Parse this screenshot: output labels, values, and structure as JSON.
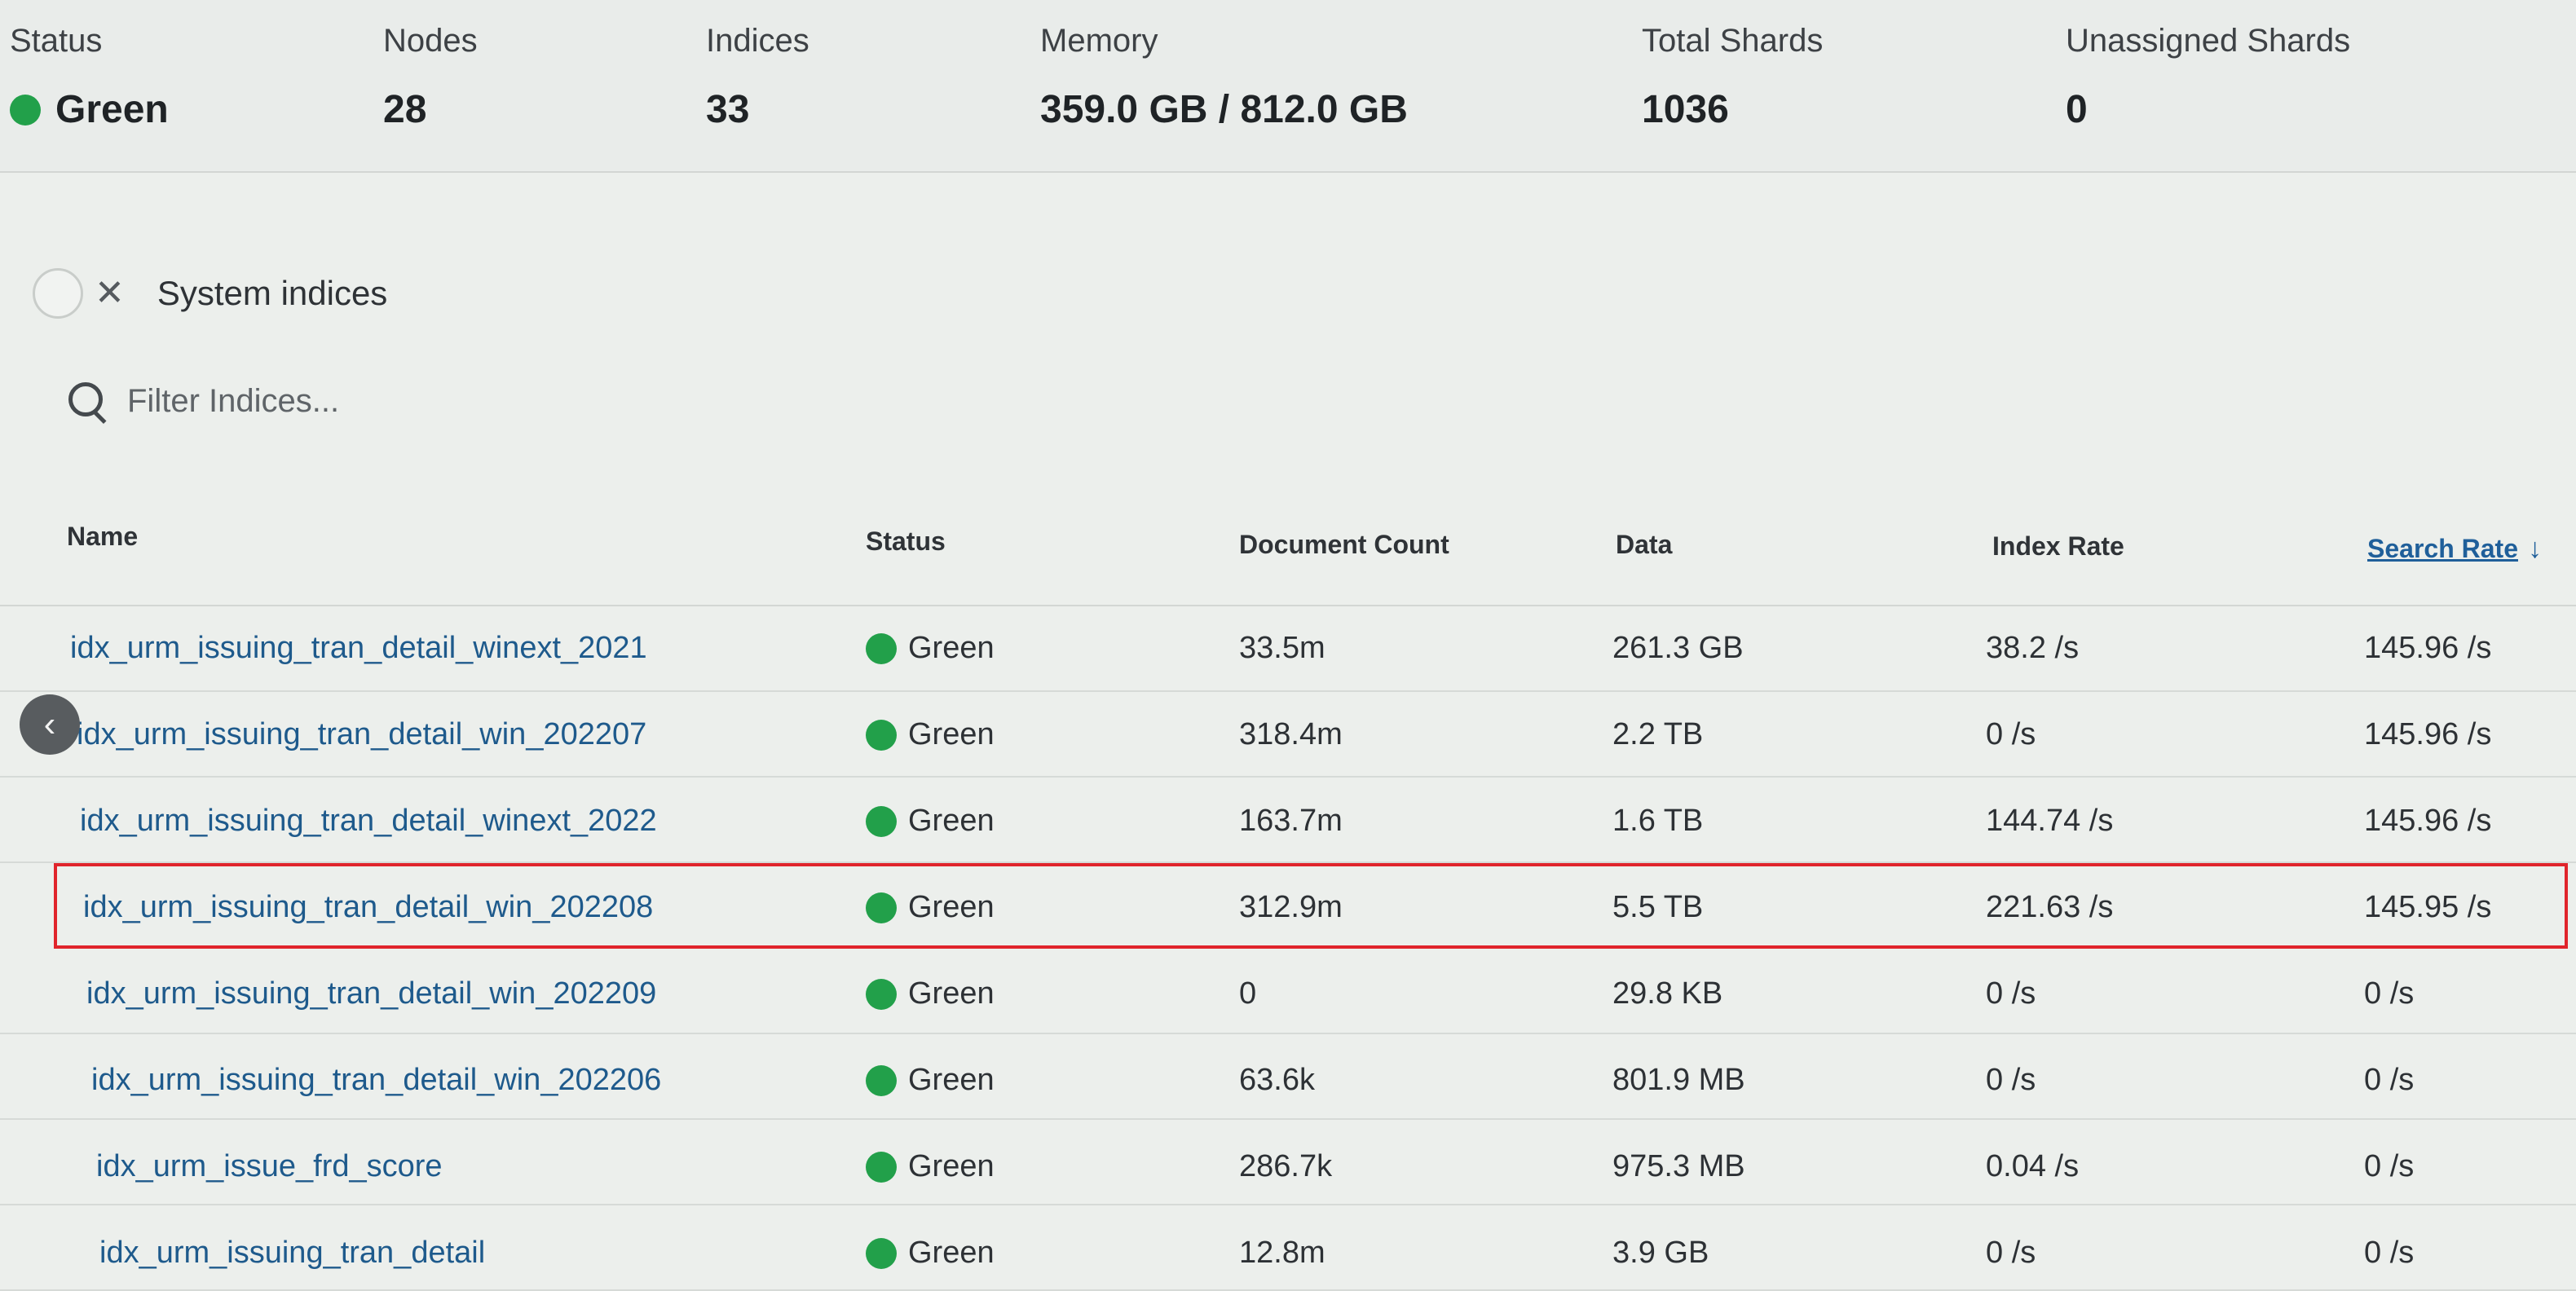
{
  "summary": {
    "status": {
      "label": "Status",
      "value": "Green",
      "color": "#22a04a"
    },
    "nodes": {
      "label": "Nodes",
      "value": "28"
    },
    "indices": {
      "label": "Indices",
      "value": "33"
    },
    "memory": {
      "label": "Memory",
      "value": "359.0 GB / 812.0 GB"
    },
    "total_shards": {
      "label": "Total Shards",
      "value": "1036"
    },
    "unassigned_shards": {
      "label": "Unassigned Shards",
      "value": "0"
    }
  },
  "system_indices": {
    "label": "System indices",
    "icon": "close-icon"
  },
  "filter": {
    "placeholder": "Filter Indices..."
  },
  "table": {
    "headers": {
      "name": "Name",
      "status": "Status",
      "doc_count": "Document Count",
      "data": "Data",
      "index_rate": "Index Rate",
      "search_rate": "Search Rate"
    },
    "sort_icon": "arrow-down-icon",
    "rows": [
      {
        "name": "idx_urm_issuing_tran_detail_winext_2021",
        "status": "Green",
        "doc_count": "33.5m",
        "data": "261.3 GB",
        "index_rate": "38.2 /s",
        "search_rate": "145.96 /s"
      },
      {
        "name": "idx_urm_issuing_tran_detail_win_202207",
        "status": "Green",
        "doc_count": "318.4m",
        "data": "2.2 TB",
        "index_rate": "0 /s",
        "search_rate": "145.96 /s"
      },
      {
        "name": "idx_urm_issuing_tran_detail_winext_2022",
        "status": "Green",
        "doc_count": "163.7m",
        "data": "1.6 TB",
        "index_rate": "144.74 /s",
        "search_rate": "145.96 /s"
      },
      {
        "name": "idx_urm_issuing_tran_detail_win_202208",
        "status": "Green",
        "doc_count": "312.9m",
        "data": "5.5 TB",
        "index_rate": "221.63 /s",
        "search_rate": "145.95 /s"
      },
      {
        "name": "idx_urm_issuing_tran_detail_win_202209",
        "status": "Green",
        "doc_count": "0",
        "data": "29.8 KB",
        "index_rate": "0 /s",
        "search_rate": "0 /s"
      },
      {
        "name": "idx_urm_issuing_tran_detail_win_202206",
        "status": "Green",
        "doc_count": "63.6k",
        "data": "801.9 MB",
        "index_rate": "0 /s",
        "search_rate": "0 /s"
      },
      {
        "name": "idx_urm_issue_frd_score",
        "status": "Green",
        "doc_count": "286.7k",
        "data": "975.3 MB",
        "index_rate": "0.04 /s",
        "search_rate": "0 /s"
      },
      {
        "name": "idx_urm_issuing_tran_detail",
        "status": "Green",
        "doc_count": "12.8m",
        "data": "3.9 GB",
        "index_rate": "0 /s",
        "search_rate": "0 /s"
      }
    ]
  },
  "nav": {
    "back_icon": "chevron-left-icon",
    "glyph": "‹"
  }
}
